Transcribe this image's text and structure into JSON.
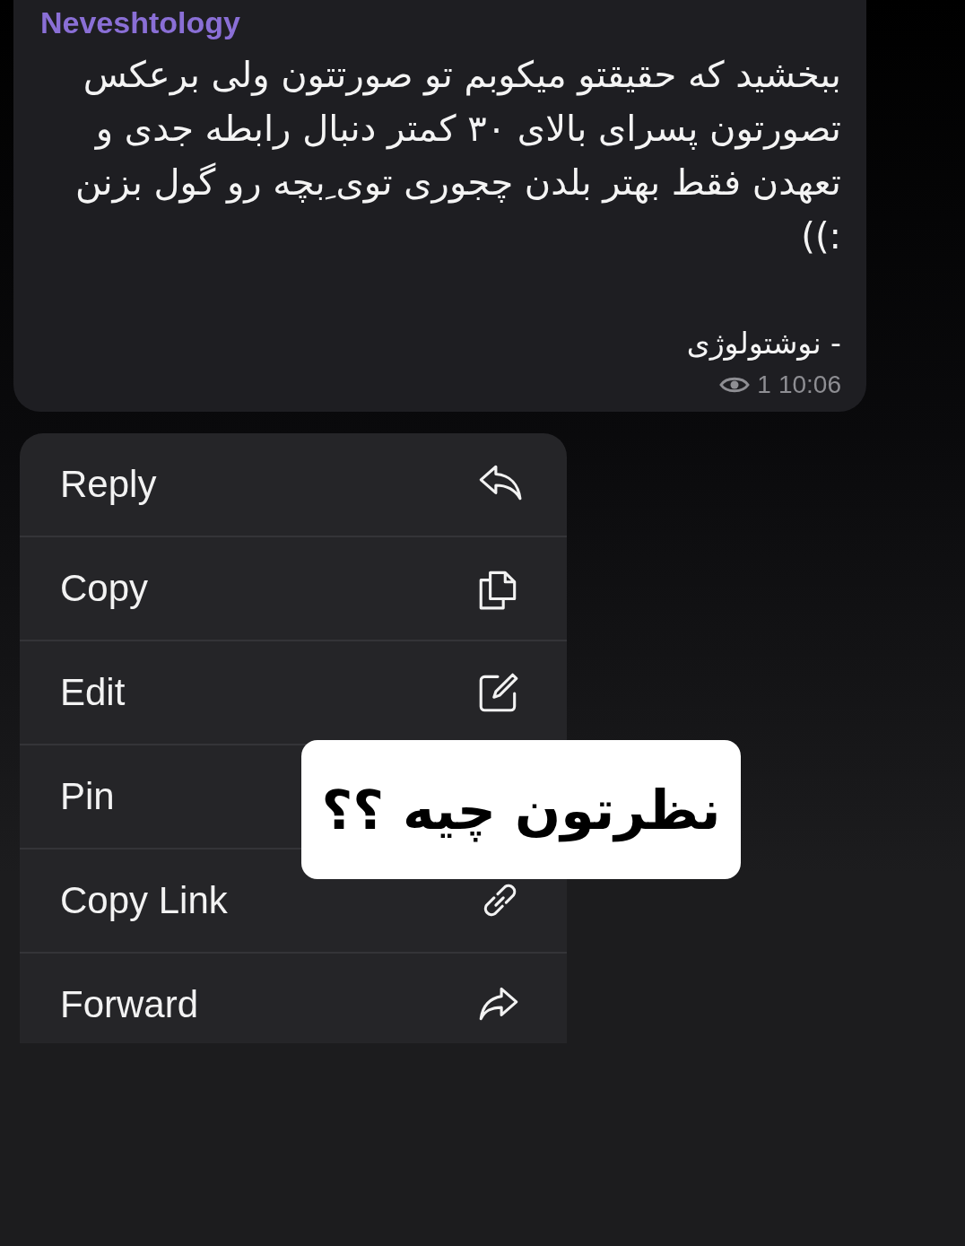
{
  "message": {
    "sender": "Neveshtology",
    "text": "ببخشید که حقیقتو میکوبم تو صورتتون ولی برعکس تصورتون پسرای بالای ۳۰ کمتر دنبال رابطه جدی و تعهدن فقط بهتر بلدن چجوری توی ِبچه رو گول بزنن :))",
    "signature": "- نوشتولوژی",
    "views": "1",
    "time": "10:06"
  },
  "context_menu": [
    {
      "label": "Reply"
    },
    {
      "label": "Copy"
    },
    {
      "label": "Edit"
    },
    {
      "label": "Pin"
    },
    {
      "label": "Copy Link"
    },
    {
      "label": "Forward"
    }
  ],
  "sticker": {
    "text": "نظرتون چیه ؟؟"
  }
}
